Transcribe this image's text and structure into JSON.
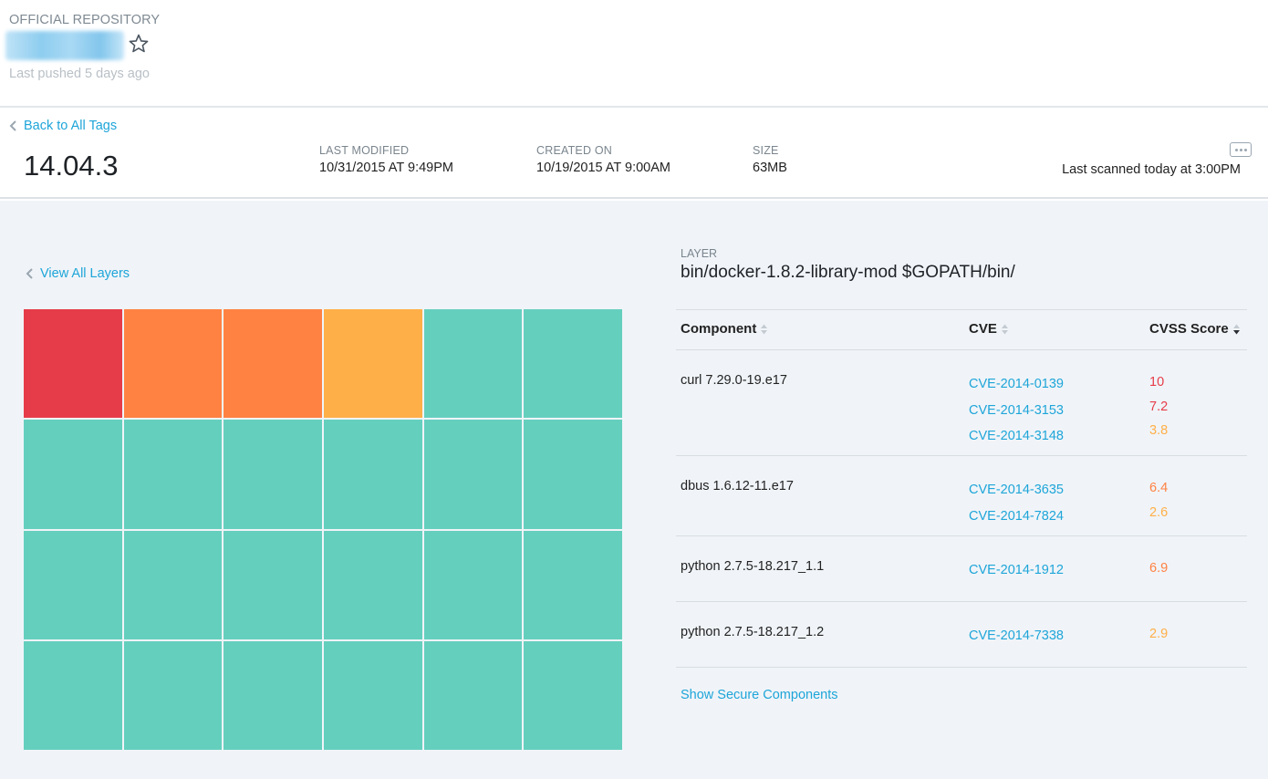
{
  "header": {
    "repo_type": "OFFICIAL REPOSITORY",
    "last_pushed": "Last pushed 5 days ago"
  },
  "tag_bar": {
    "back_link": "Back to All Tags",
    "tag_name": "14.04.3",
    "last_modified_label": "LAST MODIFIED",
    "last_modified_value": "10/31/2015 AT 9:49PM",
    "created_on_label": "CREATED ON",
    "created_on_value": "10/19/2015 AT 9:00AM",
    "size_label": "SIZE",
    "size_value": "63MB",
    "last_scanned": "Last scanned today at 3:00PM"
  },
  "layers": {
    "view_all_link": "View All Layers",
    "severity_colors": {
      "critical": "#e63c49",
      "high": "#ff8243",
      "medium": "#ffaf48",
      "safe": "#65cfbe"
    },
    "cells": [
      "critical",
      "high",
      "high",
      "medium",
      "safe",
      "safe",
      "safe",
      "safe",
      "safe",
      "safe",
      "safe",
      "safe",
      "safe",
      "safe",
      "safe",
      "safe",
      "safe",
      "safe",
      "safe",
      "safe",
      "safe",
      "safe",
      "safe",
      "safe"
    ]
  },
  "layer_detail": {
    "label": "LAYER",
    "command": "bin/docker-1.8.2-library-mod $GOPATH/bin/",
    "columns": {
      "component": "Component",
      "cve": "CVE",
      "score": "CVSS Score"
    },
    "score_colors": {
      "critical": "#e63c49",
      "high": "#ff8243",
      "medium": "#ffaf48"
    },
    "rows": [
      {
        "component": "curl 7.29.0-19.e17",
        "cves": [
          {
            "id": "CVE-2014-0139",
            "score": "10",
            "level": "critical"
          },
          {
            "id": "CVE-2014-3153",
            "score": "7.2",
            "level": "critical"
          },
          {
            "id": "CVE-2014-3148",
            "score": "3.8",
            "level": "medium"
          }
        ]
      },
      {
        "component": "dbus 1.6.12-11.e17",
        "cves": [
          {
            "id": "CVE-2014-3635",
            "score": "6.4",
            "level": "high"
          },
          {
            "id": "CVE-2014-7824",
            "score": "2.6",
            "level": "medium"
          }
        ]
      },
      {
        "component": "python 2.7.5-18.217_1.1",
        "cves": [
          {
            "id": "CVE-2014-1912",
            "score": "6.9",
            "level": "high"
          }
        ]
      },
      {
        "component": "python 2.7.5-18.217_1.2",
        "cves": [
          {
            "id": "CVE-2014-7338",
            "score": "2.9",
            "level": "medium"
          }
        ]
      }
    ],
    "show_secure": "Show Secure Components"
  }
}
